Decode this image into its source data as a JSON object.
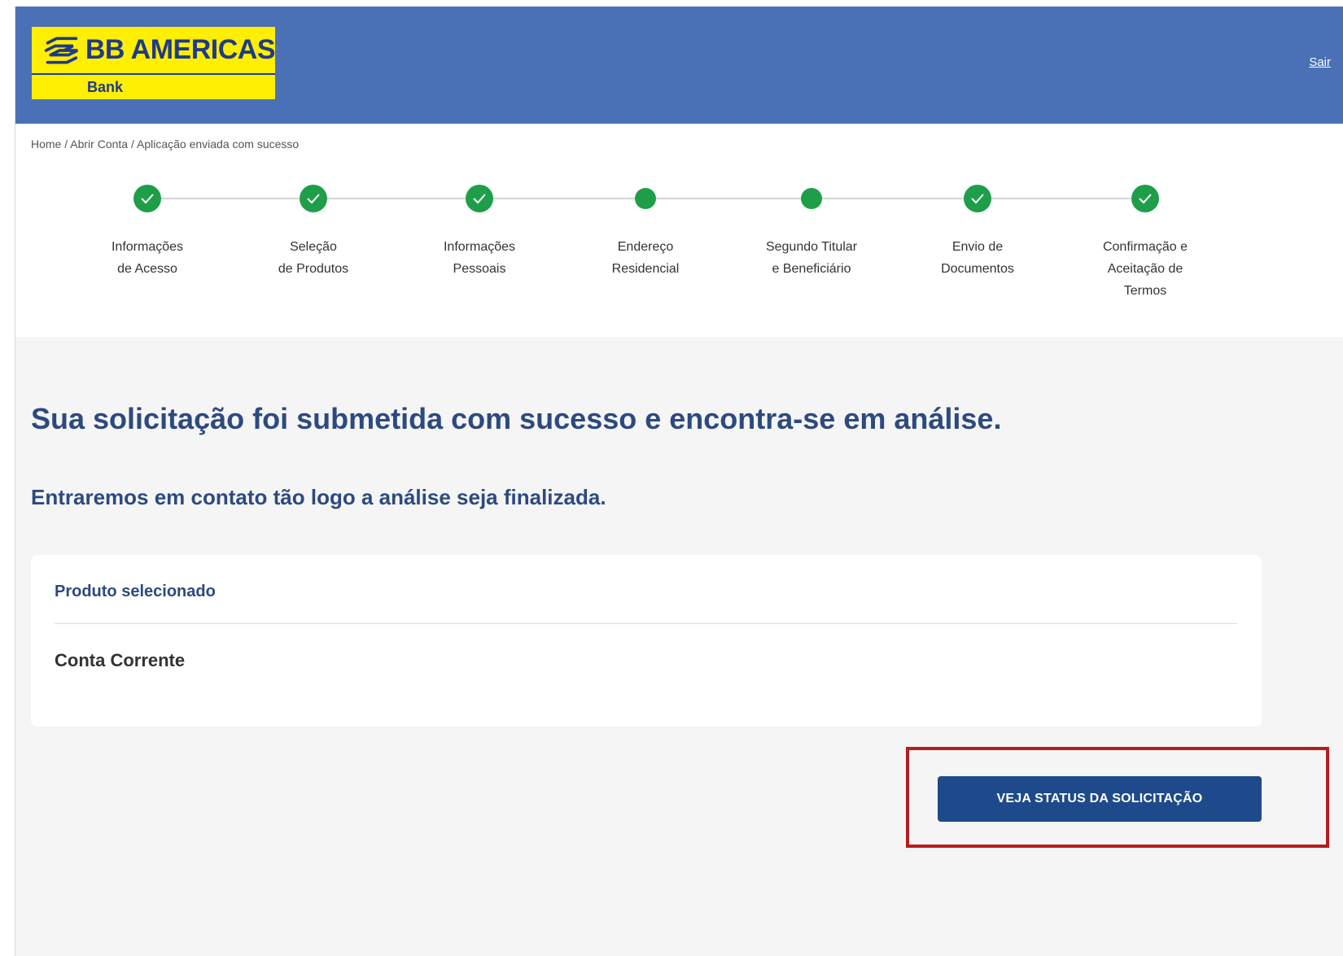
{
  "header": {
    "logo_title": "BB AMERICAS",
    "logo_subtitle": "Bank",
    "logout_label": "Sair"
  },
  "breadcrumb": {
    "items": [
      "Home",
      "Abrir Conta",
      "Aplicação enviada com sucesso"
    ],
    "separator": " / "
  },
  "steps": [
    {
      "line1": "Informações",
      "line2": "de Acesso",
      "line3": "",
      "status": "done"
    },
    {
      "line1": "Seleção",
      "line2": "de Produtos",
      "line3": "",
      "status": "done"
    },
    {
      "line1": "Informações",
      "line2": "Pessoais",
      "line3": "",
      "status": "done"
    },
    {
      "line1": "Endereço",
      "line2": "Residencial",
      "line3": "",
      "status": "partial"
    },
    {
      "line1": "Segundo Titular",
      "line2": "e Beneficiário",
      "line3": "",
      "status": "partial"
    },
    {
      "line1": "Envio de",
      "line2": "Documentos",
      "line3": "",
      "status": "done"
    },
    {
      "line1": "Confirmação e",
      "line2": "Aceitação de",
      "line3": "Termos",
      "status": "done"
    }
  ],
  "main": {
    "title": "Sua solicitação foi submetida com sucesso e encontra-se em análise.",
    "subtitle": "Entraremos em contato tão logo a análise seja finalizada.",
    "product_label": "Produto selecionado",
    "product_value": "Conta Corrente",
    "status_button": "VEJA STATUS DA SOLICITAÇÃO"
  },
  "colors": {
    "header_bg": "#4a70b6",
    "logo_bg": "#ffef00",
    "logo_text": "#1f3a8a",
    "step_green": "#1f9e4a",
    "heading": "#2d4a80",
    "button_bg": "#1e4a8c",
    "highlight": "#b71c1c"
  }
}
